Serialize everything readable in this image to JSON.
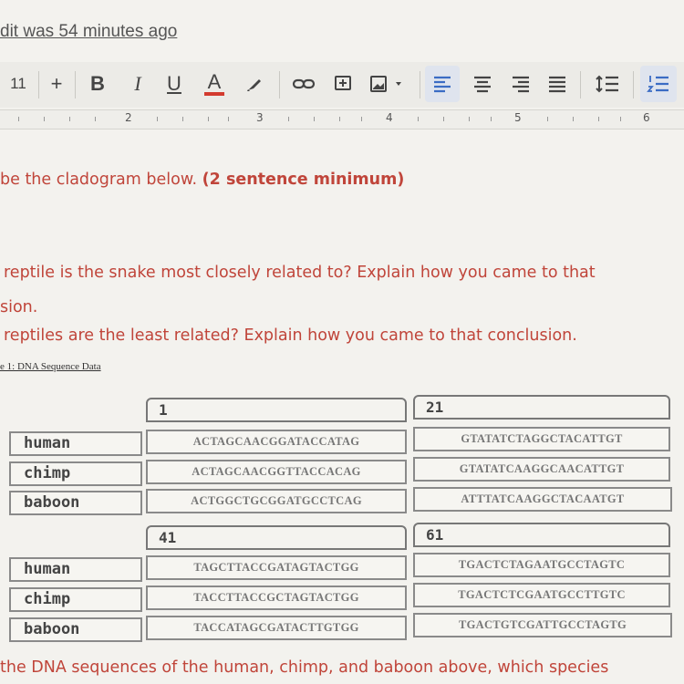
{
  "status": {
    "last_edit": "dit was 54 minutes ago"
  },
  "toolbar": {
    "font_size": "11",
    "increase_font": "+",
    "bold": "B",
    "italic": "I",
    "underline": "U",
    "text_color": "A",
    "text_color_accent": "#d33b2f"
  },
  "ruler": {
    "marks": [
      "2",
      "3",
      "4",
      "5",
      "6"
    ]
  },
  "questions": {
    "q1": "be the cladogram below.",
    "q1_min": "(2 sentence minimum)",
    "q2_line1": "reptile is the snake most closely related to? Explain how you came to that",
    "q2_line2": "sion.",
    "q3": "reptiles are the least related?  Explain how you came to that conclusion.",
    "q4": "the DNA sequences of the human, chimp, and baboon above, which species"
  },
  "table_caption": "e 1: DNA Sequence Data",
  "dna_table": {
    "species": [
      "human",
      "chimp",
      "baboon"
    ],
    "blocks": [
      {
        "start": "1",
        "sequences": [
          "ACTAGCAACGGATACCATAG",
          "ACTAGCAACGGTTACCACAG",
          "ACTGGCTGCGGATGCCTCAG"
        ]
      },
      {
        "start": "21",
        "sequences": [
          "GTATATCTAGGCTACATTGT",
          "GTATATCAAGGCAACATTGT",
          "ATTTATCAAGGCTACAATGT"
        ]
      },
      {
        "start": "41",
        "sequences": [
          "TAGCTTACCGATAGTACTGG",
          "TACCTTACCGCTAGTACTGG",
          "TACCATAGCGATACTTGTGG"
        ]
      },
      {
        "start": "61",
        "sequences": [
          "TGACTCTAGAATGCCTAGTC",
          "TGACTCTCGAATGCCTTGTC",
          "TGACTGTCGATTGCCTAGTG"
        ]
      }
    ]
  }
}
